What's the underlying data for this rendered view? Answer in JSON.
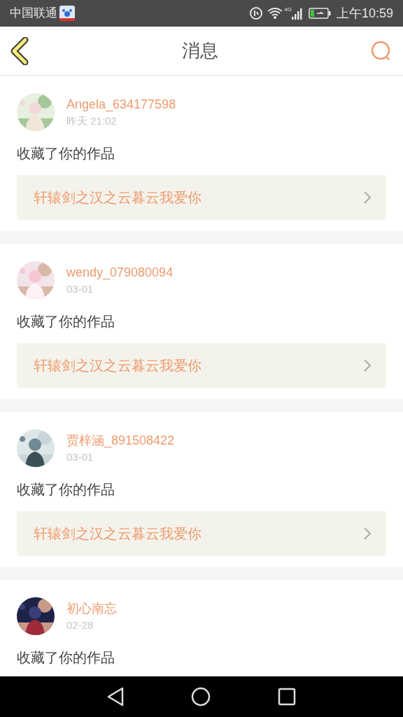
{
  "status_bar": {
    "carrier": "中国联通",
    "network": "4G",
    "time": "上午10:59"
  },
  "header": {
    "title": "消息"
  },
  "messages": [
    {
      "user": "Angela_634177598",
      "time": "昨天 21:02",
      "action": "收藏了你的作品",
      "work": "轩辕剑之汉之云暮云我爱你"
    },
    {
      "user": "wendy_079080094",
      "time": "03-01",
      "action": "收藏了你的作品",
      "work": "轩辕剑之汉之云暮云我爱你"
    },
    {
      "user": "贾梓涵_891508422",
      "time": "03-01",
      "action": "收藏了你的作品",
      "work": "轩辕剑之汉之云暮云我爱你"
    },
    {
      "user": "初心南忘",
      "time": "02-28",
      "action": "收藏了你的作品"
    }
  ]
}
